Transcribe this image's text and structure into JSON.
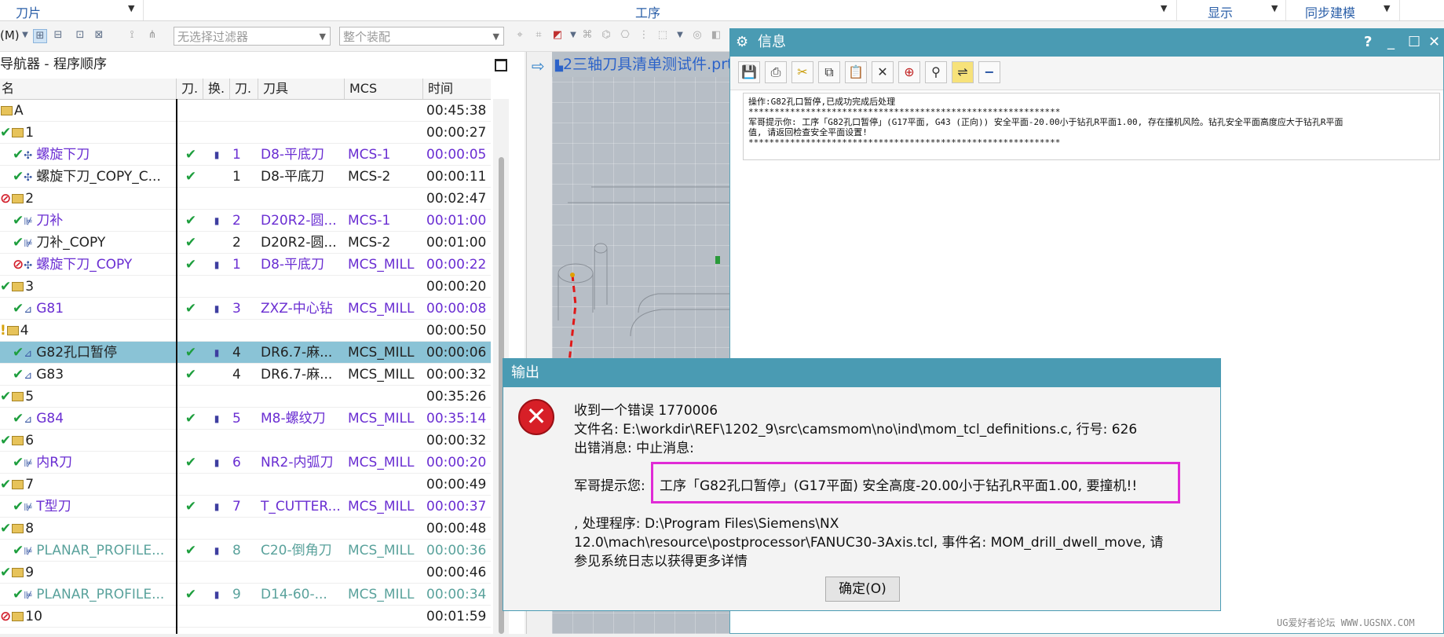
{
  "ribbon": {
    "blade_label": "刀片",
    "operation_label": "工序",
    "display_label": "显示",
    "sync_label": "同步建模"
  },
  "toolbar": {
    "left_label": "(M)",
    "filter_placeholder": "无选择过滤器",
    "assembly_placeholder": "整个装配"
  },
  "navigator": {
    "title": "导航器 - 程序顺序",
    "columns": [
      "名",
      "刀.",
      "换.",
      "刀.",
      "刀具",
      "MCS",
      "时间"
    ],
    "rows": [
      {
        "status": "",
        "icon": "group",
        "name": "A",
        "color": "blk",
        "chk": "",
        "tc": "",
        "num": "",
        "tool": "",
        "mcs": "",
        "time": "00:45:38"
      },
      {
        "status": "✔",
        "icon": "group",
        "name": "1",
        "color": "blk",
        "chk": "",
        "tc": "",
        "num": "",
        "tool": "",
        "mcs": "",
        "time": "00:00:27"
      },
      {
        "status": "✔",
        "icon": "spiral",
        "name": "螺旋下刀",
        "color": "purple",
        "chk": "✔",
        "tc": "▮",
        "num": "1",
        "tool": "D8-平底刀",
        "mcs": "MCS-1",
        "time": "00:00:05"
      },
      {
        "status": "✔",
        "icon": "spiral",
        "name": "螺旋下刀_COPY_C...",
        "color": "blk",
        "chk": "✔",
        "tc": "",
        "num": "1",
        "tool": "D8-平底刀",
        "mcs": "MCS-2",
        "time": "00:00:11"
      },
      {
        "status": "⊘",
        "icon": "group",
        "name": "2",
        "color": "blk",
        "chk": "",
        "tc": "",
        "num": "",
        "tool": "",
        "mcs": "",
        "time": "00:02:47"
      },
      {
        "status": "✔",
        "icon": "planar",
        "name": "刀补",
        "color": "purple",
        "chk": "✔",
        "tc": "▮",
        "num": "2",
        "tool": "D20R2-圆...",
        "mcs": "MCS-1",
        "time": "00:01:00"
      },
      {
        "status": "✔",
        "icon": "planar",
        "name": "刀补_COPY",
        "color": "blk",
        "chk": "✔",
        "tc": "",
        "num": "2",
        "tool": "D20R2-圆...",
        "mcs": "MCS-2",
        "time": "00:01:00"
      },
      {
        "status": "⊘",
        "icon": "spiral",
        "name": "螺旋下刀_COPY",
        "color": "purple",
        "chk": "✔",
        "tc": "▮",
        "num": "1",
        "tool": "D8-平底刀",
        "mcs": "MCS_MILL",
        "time": "00:00:22"
      },
      {
        "status": "✔",
        "icon": "group",
        "name": "3",
        "color": "blk",
        "chk": "",
        "tc": "",
        "num": "",
        "tool": "",
        "mcs": "",
        "time": "00:00:20"
      },
      {
        "status": "✔",
        "icon": "drill",
        "name": "G81",
        "color": "purple",
        "chk": "✔",
        "tc": "▮",
        "num": "3",
        "tool": "ZXZ-中心钻",
        "mcs": "MCS_MILL",
        "time": "00:00:08"
      },
      {
        "status": "!",
        "icon": "group",
        "name": "4",
        "color": "blk",
        "chk": "",
        "tc": "",
        "num": "",
        "tool": "",
        "mcs": "",
        "time": "00:00:50"
      },
      {
        "status": "✔",
        "icon": "drill",
        "name": "G82孔口暂停",
        "color": "blk",
        "chk": "✔",
        "tc": "▮",
        "num": "4",
        "tool": "DR6.7-麻...",
        "mcs": "MCS_MILL",
        "time": "00:00:06",
        "selected": true
      },
      {
        "status": "✔",
        "icon": "drill",
        "name": "G83",
        "color": "blk",
        "chk": "✔",
        "tc": "",
        "num": "4",
        "tool": "DR6.7-麻...",
        "mcs": "MCS_MILL",
        "time": "00:00:32"
      },
      {
        "status": "✔",
        "icon": "group",
        "name": "5",
        "color": "blk",
        "chk": "",
        "tc": "",
        "num": "",
        "tool": "",
        "mcs": "",
        "time": "00:35:26"
      },
      {
        "status": "✔",
        "icon": "drill",
        "name": "G84",
        "color": "purple",
        "chk": "✔",
        "tc": "▮",
        "num": "5",
        "tool": "M8-螺纹刀",
        "mcs": "MCS_MILL",
        "time": "00:35:14"
      },
      {
        "status": "✔",
        "icon": "group",
        "name": "6",
        "color": "blk",
        "chk": "",
        "tc": "",
        "num": "",
        "tool": "",
        "mcs": "",
        "time": "00:00:32"
      },
      {
        "status": "✔",
        "icon": "planar",
        "name": "内R刀",
        "color": "purple",
        "chk": "✔",
        "tc": "▮",
        "num": "6",
        "tool": "NR2-内弧刀",
        "mcs": "MCS_MILL",
        "time": "00:00:20"
      },
      {
        "status": "✔",
        "icon": "group",
        "name": "7",
        "color": "blk",
        "chk": "",
        "tc": "",
        "num": "",
        "tool": "",
        "mcs": "",
        "time": "00:00:49"
      },
      {
        "status": "✔",
        "icon": "planar",
        "name": "T型刀",
        "color": "purple",
        "chk": "✔",
        "tc": "▮",
        "num": "7",
        "tool": "T_CUTTER...",
        "mcs": "MCS_MILL",
        "time": "00:00:37"
      },
      {
        "status": "✔",
        "icon": "group",
        "name": "8",
        "color": "blk",
        "chk": "",
        "tc": "",
        "num": "",
        "tool": "",
        "mcs": "",
        "time": "00:00:48"
      },
      {
        "status": "✔",
        "icon": "planar",
        "name": "PLANAR_PROFILE...",
        "color": "teal",
        "chk": "✔",
        "tc": "▮",
        "num": "8",
        "tool": "C20-倒角刀",
        "mcs": "MCS_MILL",
        "time": "00:00:36"
      },
      {
        "status": "✔",
        "icon": "group",
        "name": "9",
        "color": "blk",
        "chk": "",
        "tc": "",
        "num": "",
        "tool": "",
        "mcs": "",
        "time": "00:00:46"
      },
      {
        "status": "✔",
        "icon": "planar",
        "name": "PLANAR_PROFILE...",
        "color": "teal",
        "chk": "✔",
        "tc": "▮",
        "num": "9",
        "tool": "D14-60-...",
        "mcs": "MCS_MILL",
        "time": "00:00:34"
      },
      {
        "status": "⊘",
        "icon": "group",
        "name": "10",
        "color": "blk",
        "chk": "",
        "tc": "",
        "num": "",
        "tool": "",
        "mcs": "",
        "time": "00:01:59"
      }
    ]
  },
  "graphics": {
    "tab_title": "2三轴刀具清单测试件.prt"
  },
  "info": {
    "title": "信息",
    "help": "?",
    "text": "操作:G82孔口暂停,已成功完成后处理\n************************************************************\n军哥提示你: 工序「G82孔口暂停」(G17平面, G43 (正向)) 安全平面-20.00小于钻孔R平面1.00, 存在撞机风险。钻孔安全平面高度应大于钻孔R平面\n值, 请返回检查安全平面设置!\n************************************************************"
  },
  "output": {
    "title": "输出",
    "line1": "收到一个错误 1770006",
    "line2": "文件名: E:\\workdir\\REF\\1202_9\\src\\camsmom\\no\\ind\\mom_tcl_definitions.c, 行号: 626",
    "line3": "出错消息: 中止消息:",
    "prompt_label": "军哥提示您:",
    "prompt_text": "工序「G82孔口暂停」(G17平面) 安全高度-20.00小于钻孔R平面1.00, 要撞机!!",
    "line5": ", 处理程序: D:\\Program Files\\Siemens\\NX",
    "line6": "12.0\\mach\\resource\\postprocessor\\FANUC30-3Axis.tcl, 事件名: MOM_drill_dwell_move, 请",
    "line7": "参见系统日志以获得更多详情",
    "ok_label": "确定(O)"
  },
  "watermark": "UG爱好者论坛 WWW.UGSNX.COM"
}
